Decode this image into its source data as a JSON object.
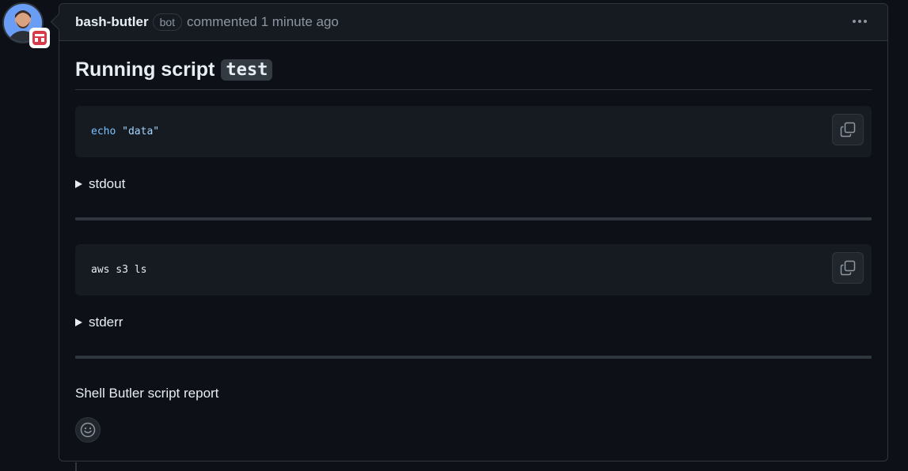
{
  "comment": {
    "author": "bash-butler",
    "bot_label": "bot",
    "meta": "commented 1 minute ago",
    "heading_prefix": "Running script",
    "heading_code": "test",
    "blocks": [
      {
        "code_keyword": "echo",
        "code_string": "\"data\"",
        "summary": "stdout"
      },
      {
        "code_plain": "aws s3 ls",
        "summary": "stderr"
      }
    ],
    "footer": "Shell Butler script report"
  },
  "icons": {
    "menu": "kebab-horizontal-icon",
    "copy": "copy-icon",
    "reaction": "smiley-icon",
    "badge": "app-badge-icon"
  },
  "colors": {
    "background": "#0d1117",
    "header_bg": "#161b22",
    "border": "#30363d",
    "keyword": "#79c0ff",
    "string": "#a5d6ff",
    "muted": "#8d96a0"
  }
}
